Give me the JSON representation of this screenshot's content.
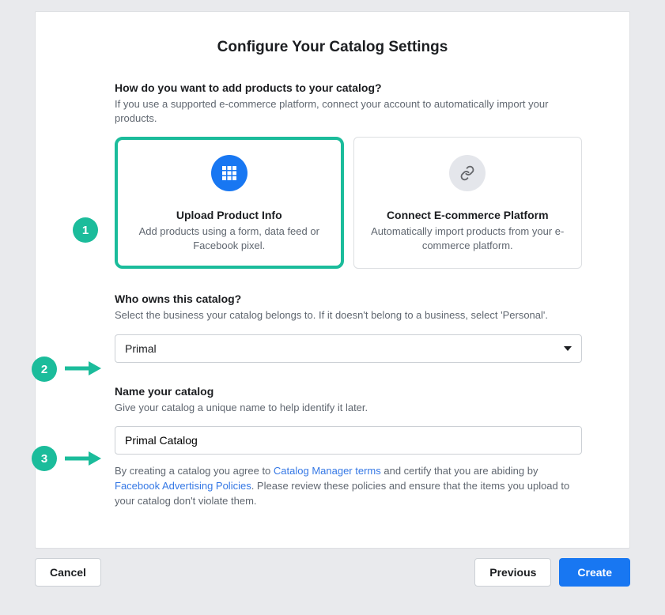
{
  "title": "Configure Your Catalog Settings",
  "section_add": {
    "heading": "How do you want to add products to your catalog?",
    "sub": "If you use a supported e-commerce platform, connect your account to automatically import your products.",
    "options": [
      {
        "title": "Upload Product Info",
        "desc": "Add products using a form, data feed or Facebook pixel."
      },
      {
        "title": "Connect E-commerce Platform",
        "desc": "Automatically import products from your e-commerce platform."
      }
    ]
  },
  "section_owner": {
    "heading": "Who owns this catalog?",
    "sub": "Select the business your catalog belongs to. If it doesn't belong to a business, select 'Personal'.",
    "selected": "Primal"
  },
  "section_name": {
    "heading": "Name your catalog",
    "sub": "Give your catalog a unique name to help identify it later.",
    "value": "Primal Catalog"
  },
  "legal": {
    "pre": "By creating a catalog you agree to ",
    "link1": "Catalog Manager terms",
    "mid": " and certify that you are abiding by ",
    "link2": "Facebook Advertising Policies",
    "post": ". Please review these policies and ensure that the items you upload to your catalog don't violate them."
  },
  "buttons": {
    "cancel": "Cancel",
    "previous": "Previous",
    "create": "Create"
  },
  "annotations": {
    "step1": "1",
    "step2": "2",
    "step3": "3"
  }
}
